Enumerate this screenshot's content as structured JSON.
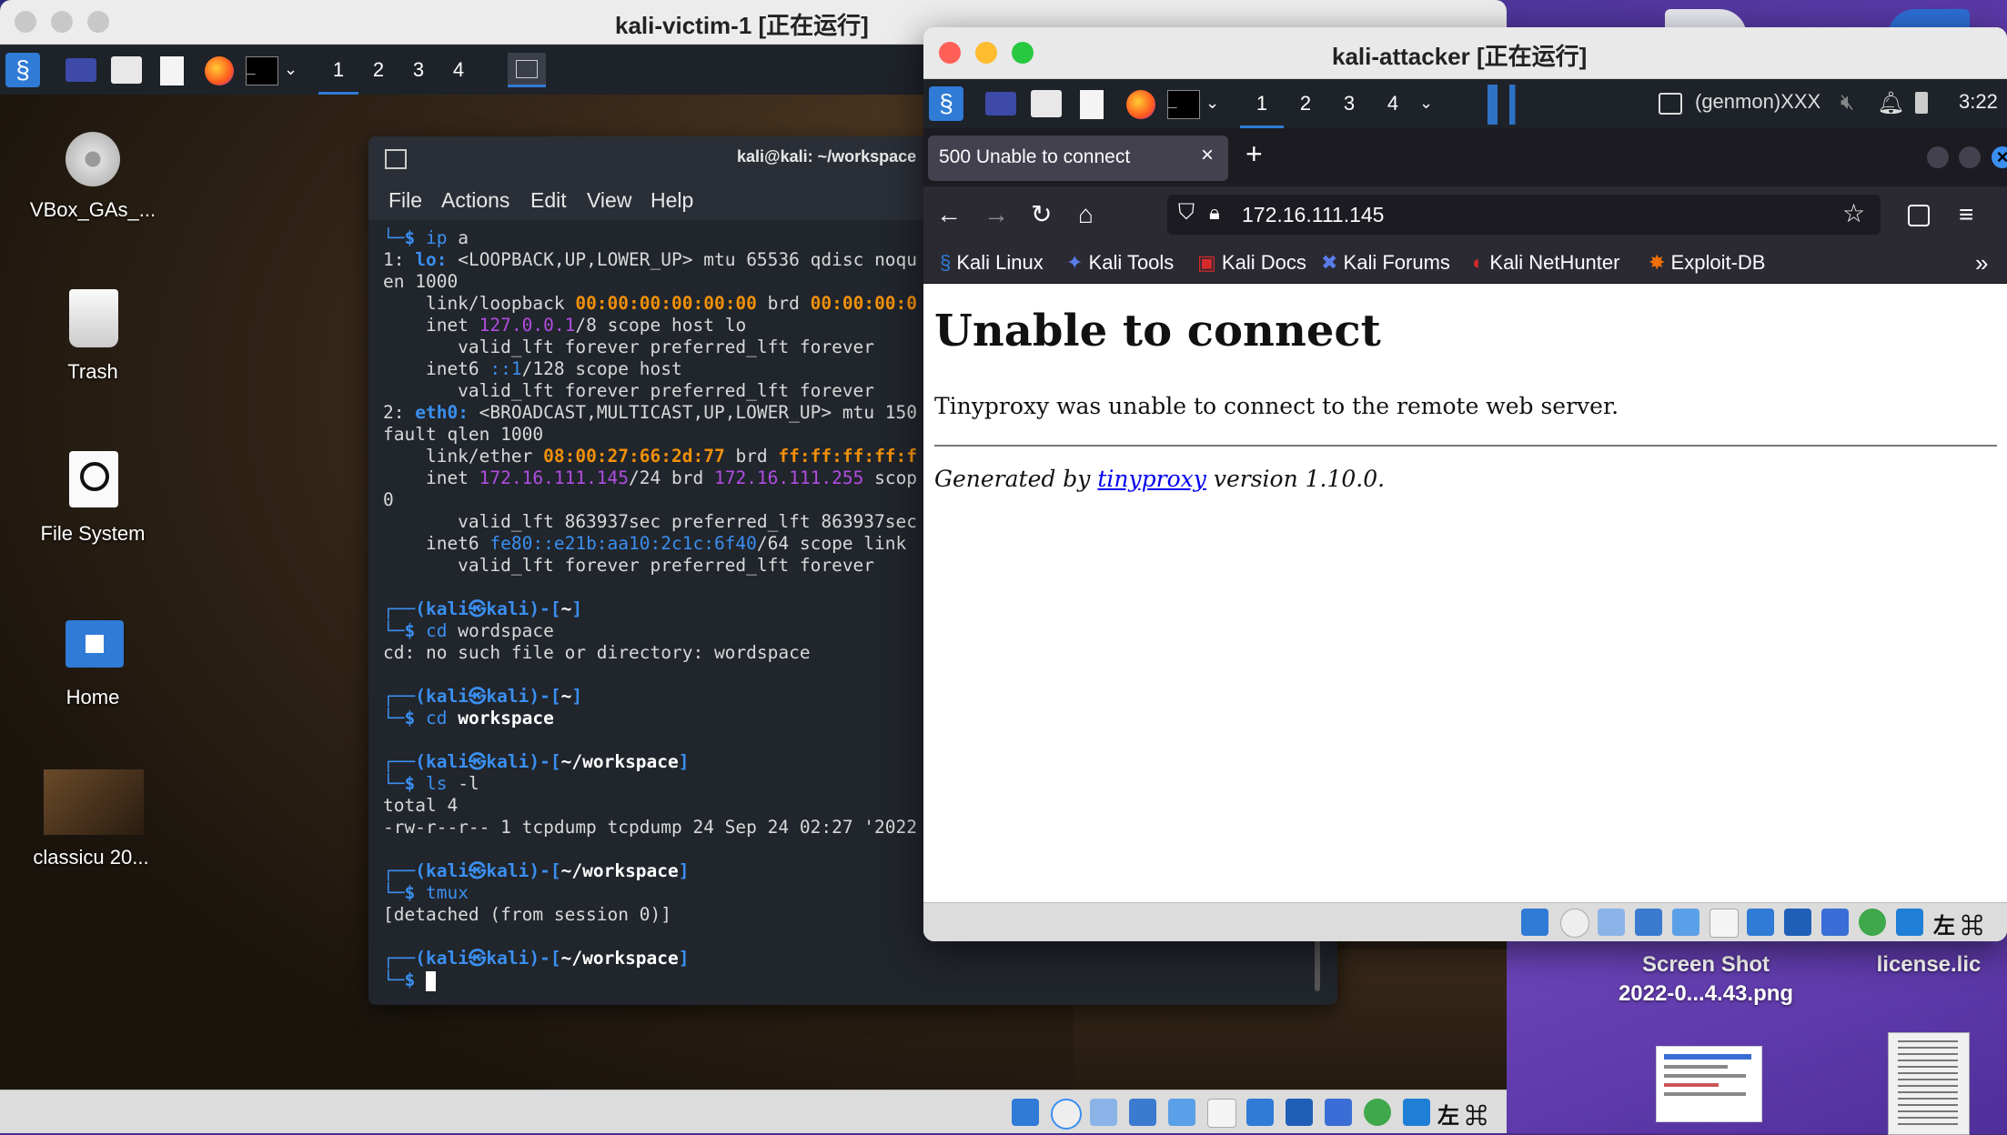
{
  "mac_desktop": {
    "files": [
      {
        "name": "Screen Shot\n2022-0...4.43.png"
      },
      {
        "name": "license.lic"
      }
    ]
  },
  "victim": {
    "window_title": "kali-victim-1 [正在运行]",
    "workspaces": [
      "1",
      "2",
      "3",
      "4"
    ],
    "desktop_icons": [
      {
        "label": "VBox_GAs_...",
        "icon": "cdrom-icon"
      },
      {
        "label": "Trash",
        "icon": "trash-icon"
      },
      {
        "label": "File System",
        "icon": "drive-icon"
      },
      {
        "label": "Home",
        "icon": "home-folder-icon"
      },
      {
        "label": "classicu 20...",
        "icon": "image-thumbnail-icon"
      }
    ],
    "bottom_text": "左 ⌘"
  },
  "terminal": {
    "title": "kali@kali: ~/workspace",
    "menu": [
      "File",
      "Actions",
      "Edit",
      "View",
      "Help"
    ]
  },
  "attacker": {
    "window_title": "kali-attacker [正在运行]",
    "workspaces": [
      "1",
      "2",
      "3",
      "4"
    ],
    "genmon": "(genmon)XXX",
    "clock": "3:22",
    "tab_title": "500 Unable to connect",
    "url": "172.16.111.145",
    "bookmarks": [
      "Kali Linux",
      "Kali Tools",
      "Kali Docs",
      "Kali Forums",
      "Kali NetHunter",
      "Exploit-DB"
    ],
    "page": {
      "heading": "Unable to connect",
      "paragraph": "Tinyproxy was unable to connect to the remote web server.",
      "footer_prefix": "Generated by ",
      "footer_link": "tinyproxy",
      "footer_suffix": " version 1.10.0."
    },
    "bottom_text": "左 ⌘"
  },
  "colors": {
    "kali_blue": "#3a8ff0",
    "terminal_bg": "#21252c",
    "firefox_dark": "#2b2a33"
  }
}
